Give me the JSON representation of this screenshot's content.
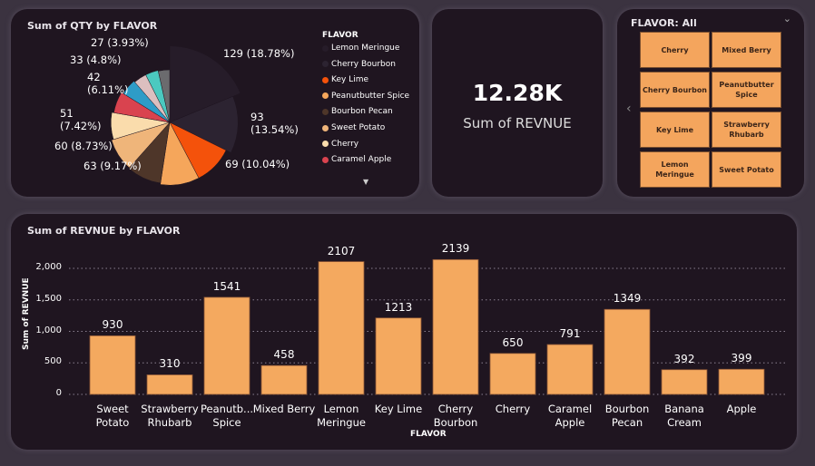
{
  "pie": {
    "title": "Sum of QTY by FLAVOR",
    "legend_title": "FLAVOR",
    "slices": [
      {
        "name": "Lemon Meringue",
        "value": 129,
        "label": "129 (18.78%)",
        "color": "#261c29"
      },
      {
        "name": "Cherry Bourbon",
        "value": 93,
        "label": "93\n(13.54%)",
        "color": "#2c2331"
      },
      {
        "name": "Key Lime",
        "value": 69,
        "label": "69 (10.04%)",
        "color": "#f4520b"
      },
      {
        "name": "Peanutbutter Spice",
        "value": 69,
        "label": "",
        "color": "#f5a65b"
      },
      {
        "name": "Bourbon Pecan",
        "value": 63,
        "label": "63 (9.17%)",
        "color": "#4e3629"
      },
      {
        "name": "Sweet Potato",
        "value": 60,
        "label": "60 (8.73%)",
        "color": "#efb57a"
      },
      {
        "name": "Cherry",
        "value": 51,
        "label": "51\n(7.42%)",
        "color": "#fadcac"
      },
      {
        "name": "Caramel Apple",
        "value": 42,
        "label": "42\n(6.11%)",
        "color": "#d9434f"
      },
      {
        "name": "",
        "value": 33,
        "label": "33 (4.8%)",
        "color": "#2e9cc7"
      },
      {
        "name": "",
        "value": 27,
        "label": "",
        "color": "#dcbfbf"
      },
      {
        "name": "",
        "value": 27,
        "label": "27 (3.93%)",
        "color": "#4bc9c0"
      },
      {
        "name": "",
        "value": 24,
        "label": "",
        "color": "#6b6b6e"
      }
    ]
  },
  "kpi": {
    "value": "12.28K",
    "label": "Sum of REVNUE"
  },
  "slicer": {
    "title": "FLAVOR: All",
    "options": [
      "Cherry",
      "Mixed Berry",
      "Cherry Bourbon",
      "Peanutbutter Spice",
      "Key Lime",
      "Strawberry Rhubarb",
      "Lemon Meringue",
      "Sweet Potato"
    ]
  },
  "chart_data": {
    "type": "bar",
    "title": "Sum of REVNUE by FLAVOR",
    "xlabel": "FLAVOR",
    "ylabel": "Sum of REVNUE",
    "ylim": [
      0,
      2000
    ],
    "grid": true,
    "yticks": [
      "0",
      "500",
      "1,000",
      "1,500",
      "2,000"
    ],
    "categories": [
      "Sweet Potato",
      "Strawberry Rhubarb",
      "Peanutb... Spice",
      "Mixed Berry",
      "Lemon Meringue",
      "Key Lime",
      "Cherry Bourbon",
      "Cherry",
      "Caramel Apple",
      "Bourbon Pecan",
      "Banana Cream",
      "Apple"
    ],
    "values": [
      930,
      310,
      1541,
      458,
      2107,
      1213,
      2139,
      650,
      791,
      1349,
      392,
      399
    ],
    "color": "#f4a95f"
  }
}
